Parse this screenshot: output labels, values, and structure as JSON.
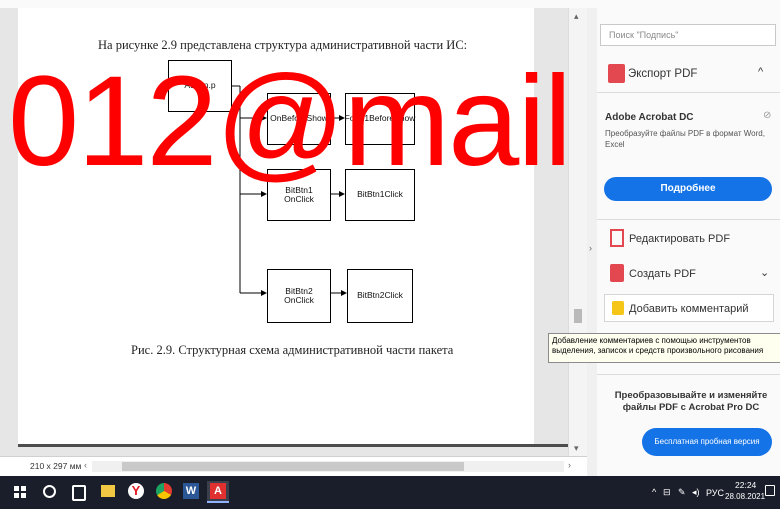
{
  "document": {
    "intro": "На рисунке 2.9 представлена структура административной части ИС:",
    "caption": "Рис. 2.9. Структурная схема административной части пакета",
    "page_size": "210 x 297 мм"
  },
  "diagram": {
    "root": "Admin.p",
    "nodes": [
      {
        "label": "OnBeforeShow",
        "target": "Form1BeforeShow"
      },
      {
        "label": "BitBtn1\nOnClick",
        "target": "BitBtn1Click"
      },
      {
        "label": "BitBtn2\nOnClick",
        "target": "BitBtn2Click"
      }
    ]
  },
  "panel": {
    "search_placeholder": "Поиск \"Подпись\"",
    "export_label": "Экспорт PDF",
    "promo_title": "Adobe Acrobat DC",
    "promo_text": "Преобразуйте файлы PDF в формат Word, Excel",
    "more_button": "Подробнее",
    "tools": [
      {
        "label": "Редактировать PDF",
        "icon": "edit-pdf-icon"
      },
      {
        "label": "Создать PDF",
        "icon": "create-pdf-icon"
      },
      {
        "label": "Добавить комментарий",
        "icon": "comment-icon"
      }
    ],
    "tooltip": "Добавление комментариев с помощью инструментов выделения, записок и средств произвольного рисования",
    "cta_title": "Преобразовывайте и изменяйте файлы PDF с Acrobat Pro DC",
    "cta_button": "Бесплатная пробная версия"
  },
  "watermark": "012@mail",
  "taskbar": {
    "lang": "РУС",
    "time": "22:24",
    "date": "28.08.2021"
  },
  "colors": {
    "accent_blue": "#1473e6",
    "watermark_red": "#ff0000",
    "taskbar": "#1a1e2a"
  }
}
